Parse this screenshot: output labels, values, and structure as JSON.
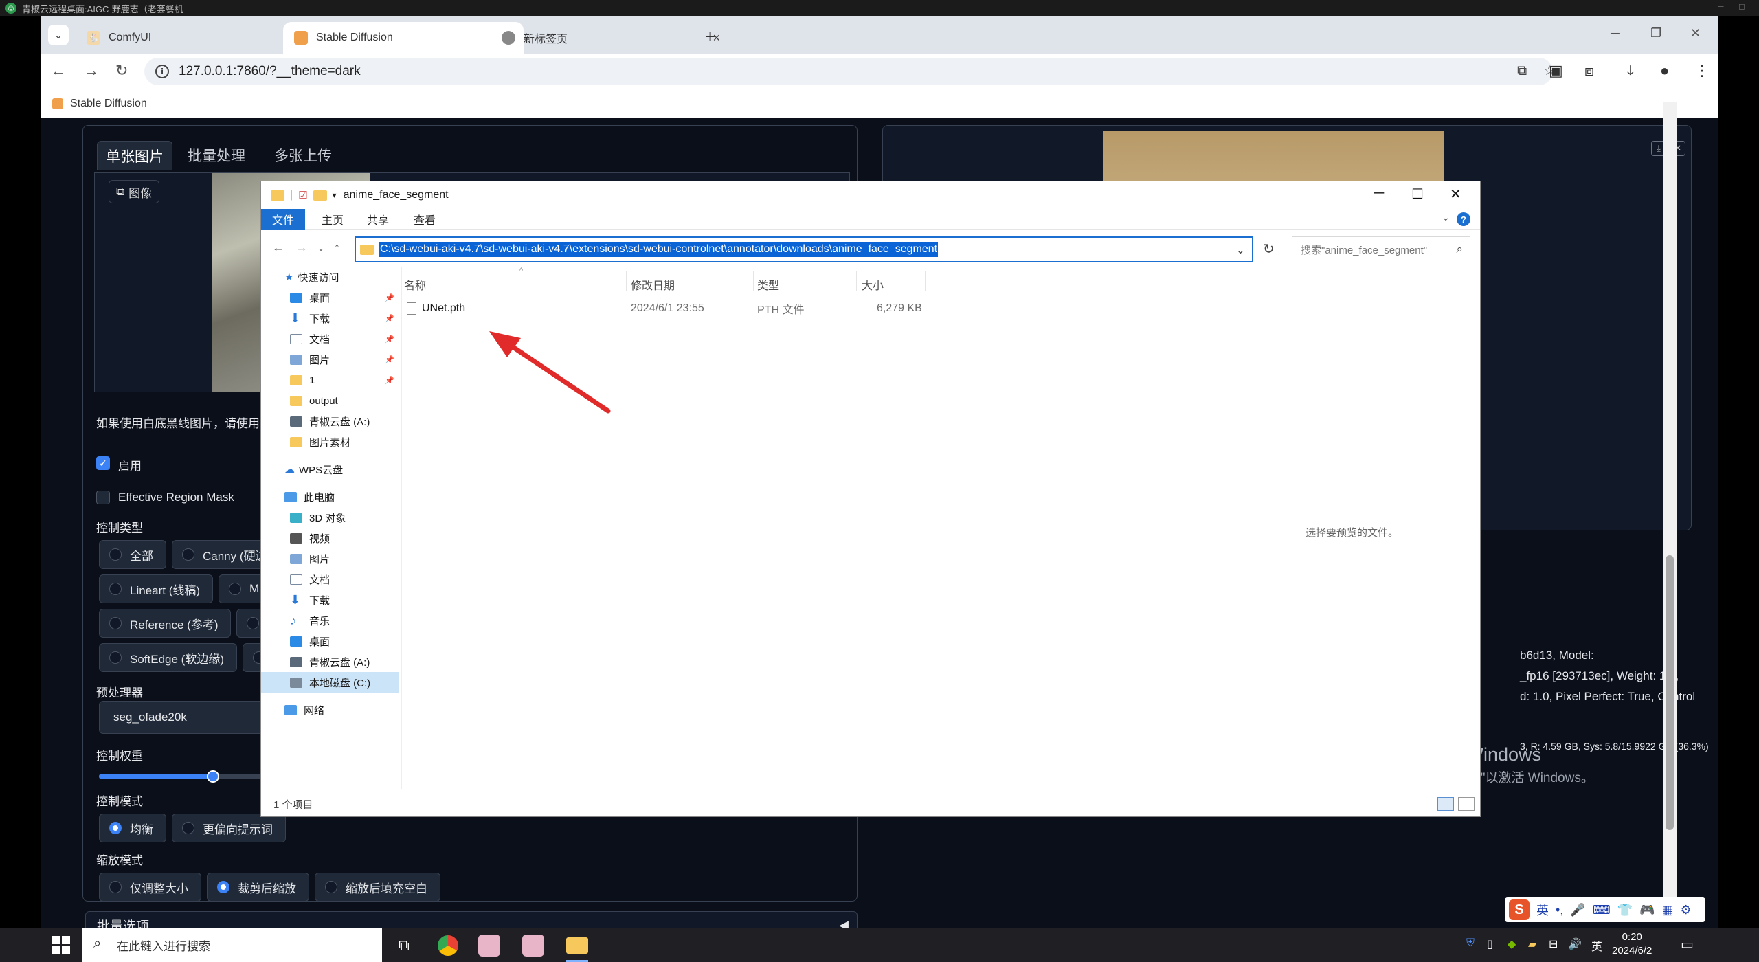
{
  "remote": {
    "title": "青椒云远程桌面:AIGC-野鹿志（老套餐机"
  },
  "browser": {
    "tabs": [
      {
        "label": "ComfyUI",
        "close": "×"
      },
      {
        "label": "Stable Diffusion",
        "close": "×"
      },
      {
        "label": "新标签页",
        "close": "×"
      }
    ],
    "new_tab": "+",
    "url": "127.0.0.1:7860/?__theme=dark",
    "bookmark": "Stable Diffusion"
  },
  "sd": {
    "tabs": [
      "单张图片",
      "批量处理",
      "多张上传"
    ],
    "image_label": "图像",
    "hint": "如果使用白底黑线图片，请使用",
    "enable_label": "启用",
    "effective_region_label": "Effective Region Mask",
    "control_type_label": "控制类型",
    "control_types_row1": [
      "全部",
      "Canny (硬边"
    ],
    "control_types_row2": [
      "Lineart (线稿)",
      "MLS"
    ],
    "control_types_row3": [
      "Reference (参考)",
      ""
    ],
    "control_types_row4": [
      "SoftEdge (软边缘)",
      ""
    ],
    "preprocessor_label": "预处理器",
    "preprocessor_value": "seg_ofade20k",
    "weight_label": "控制权重",
    "weight_fraction": 0.16,
    "control_mode_label": "控制模式",
    "control_modes": [
      "均衡",
      "更偏向提示词"
    ],
    "resize_label": "缩放模式",
    "resize_modes": [
      "仅调整大小",
      "裁剪后缩放",
      "缩放后填充空白"
    ],
    "batch_options": "批量选项",
    "info_lines": [
      "b6d13, Model:",
      "_fp16 [293713ec], Weight: 1.0,",
      "d: 1.0, Pixel Perfect: True, Control"
    ],
    "mem_line": "3, R: 4.59 GB, Sys: 5.8/15.9922 GB (36.3%)"
  },
  "explorer": {
    "title": "anime_face_segment",
    "ribbon": [
      "文件",
      "主页",
      "共享",
      "查看"
    ],
    "help": "?",
    "address": "C:\\sd-webui-aki-v4.7\\sd-webui-aki-v4.7\\extensions\\sd-webui-controlnet\\annotator\\downloads\\anime_face_segment",
    "search_placeholder": "搜索\"anime_face_segment\"",
    "columns": [
      "名称",
      "修改日期",
      "类型",
      "大小"
    ],
    "files": [
      {
        "name": "UNet.pth",
        "date": "2024/6/1 23:55",
        "type": "PTH 文件",
        "size": "6,279 KB"
      }
    ],
    "nav": {
      "quick": "快速访问",
      "quick_items": [
        "桌面",
        "下载",
        "文档",
        "图片",
        "1",
        "output",
        "青椒云盘 (A:)",
        "图片素材"
      ],
      "wps": "WPS云盘",
      "pc": "此电脑",
      "pc_items": [
        "3D 对象",
        "视频",
        "图片",
        "文档",
        "下载",
        "音乐",
        "桌面",
        "青椒云盘 (A:)",
        "本地磁盘 (C:)"
      ],
      "network": "网络"
    },
    "preview_text": "选择要预览的文件。",
    "status": "1 个项目"
  },
  "windows": {
    "activate_title": "激活 Windows",
    "activate_sub": "转到\"设置\"以激活 Windows。",
    "search_placeholder": "在此键入进行搜索",
    "ime_mode": "英",
    "tray_lang": "英",
    "time": "0:20",
    "date": "2024/6/2"
  },
  "colors": {
    "accent": "#3b82f6",
    "explorer_blue": "#1a6fd0",
    "arrow_red": "#e12a2a"
  }
}
